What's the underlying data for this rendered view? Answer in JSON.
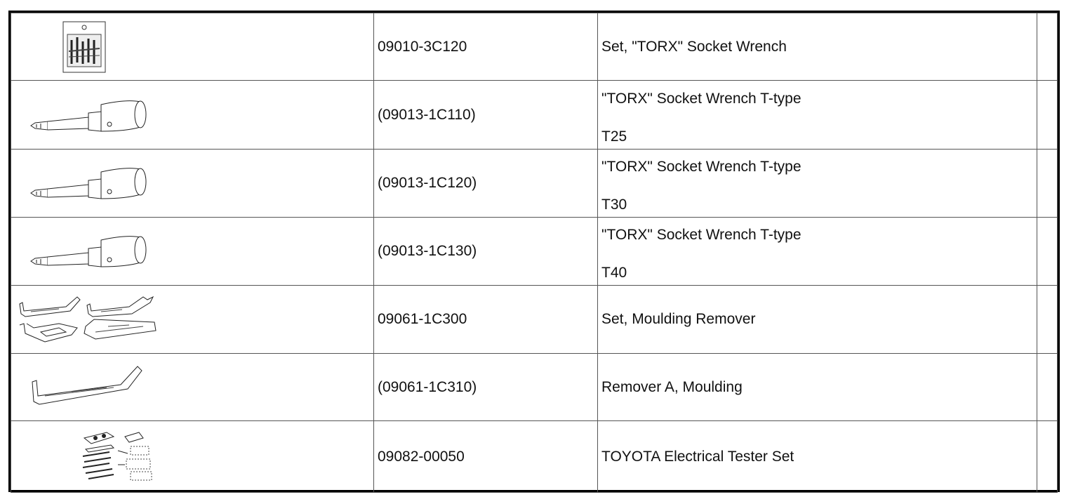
{
  "rows": [
    {
      "icon": "torx-socket-wrench-set-icon",
      "part_no": "09010-3C120",
      "description": "Set, \"TORX\" Socket Wrench",
      "sub": ""
    },
    {
      "icon": "torx-socket-wrench-t-type-icon",
      "part_no": "(09013-1C110)",
      "description": "\"TORX\" Socket Wrench T-type",
      "sub": "T25"
    },
    {
      "icon": "torx-socket-wrench-t-type-icon",
      "part_no": "(09013-1C120)",
      "description": "\"TORX\" Socket Wrench T-type",
      "sub": "T30"
    },
    {
      "icon": "torx-socket-wrench-t-type-icon",
      "part_no": "(09013-1C130)",
      "description": "\"TORX\" Socket Wrench T-type",
      "sub": "T40"
    },
    {
      "icon": "moulding-remover-set-icon",
      "part_no": "09061-1C300",
      "description": "Set, Moulding Remover",
      "sub": ""
    },
    {
      "icon": "moulding-remover-a-icon",
      "part_no": "(09061-1C310)",
      "description": "Remover A, Moulding",
      "sub": ""
    },
    {
      "icon": "electrical-tester-set-icon",
      "part_no": "09082-00050",
      "description": "TOYOTA Electrical Tester Set",
      "sub": ""
    }
  ]
}
